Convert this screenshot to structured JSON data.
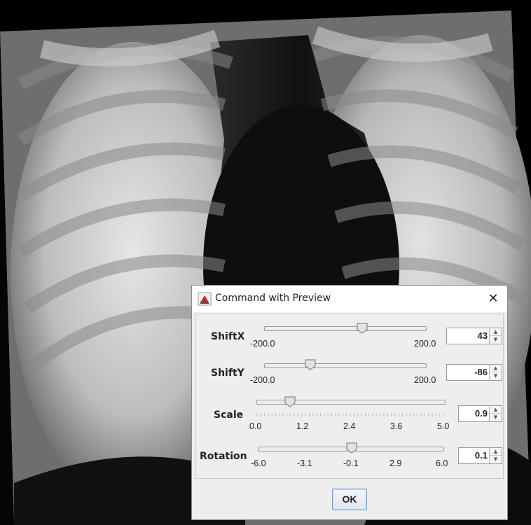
{
  "dialog": {
    "title": "Command with Preview",
    "ok_label": "OK"
  },
  "controls": [
    {
      "label": "ShiftX",
      "min_label": "-200.0",
      "max_label": "200.0",
      "value": "43",
      "level": 0.6075
    },
    {
      "label": "ShiftY",
      "min_label": "-200.0",
      "max_label": "200.0",
      "value": "-86",
      "level": 0.285
    },
    {
      "label": "Scale",
      "ticks": [
        "0.0",
        "1.2",
        "2.4",
        "3.6",
        "5.0"
      ],
      "value": "0.9",
      "level": 0.18
    },
    {
      "label": "Rotation",
      "ticks": [
        "-6.0",
        "-3.1",
        "-0.1",
        "2.9",
        "6.0"
      ],
      "value": "0.1",
      "level": 0.508
    }
  ],
  "colors": {
    "dialog_bg": "#eeeeee",
    "accent": "#7a9cc8"
  },
  "icons": {
    "app": "java-app-icon",
    "close": "close-icon",
    "spinner_up": "spinner-up-icon",
    "spinner_down": "spinner-down-icon"
  }
}
